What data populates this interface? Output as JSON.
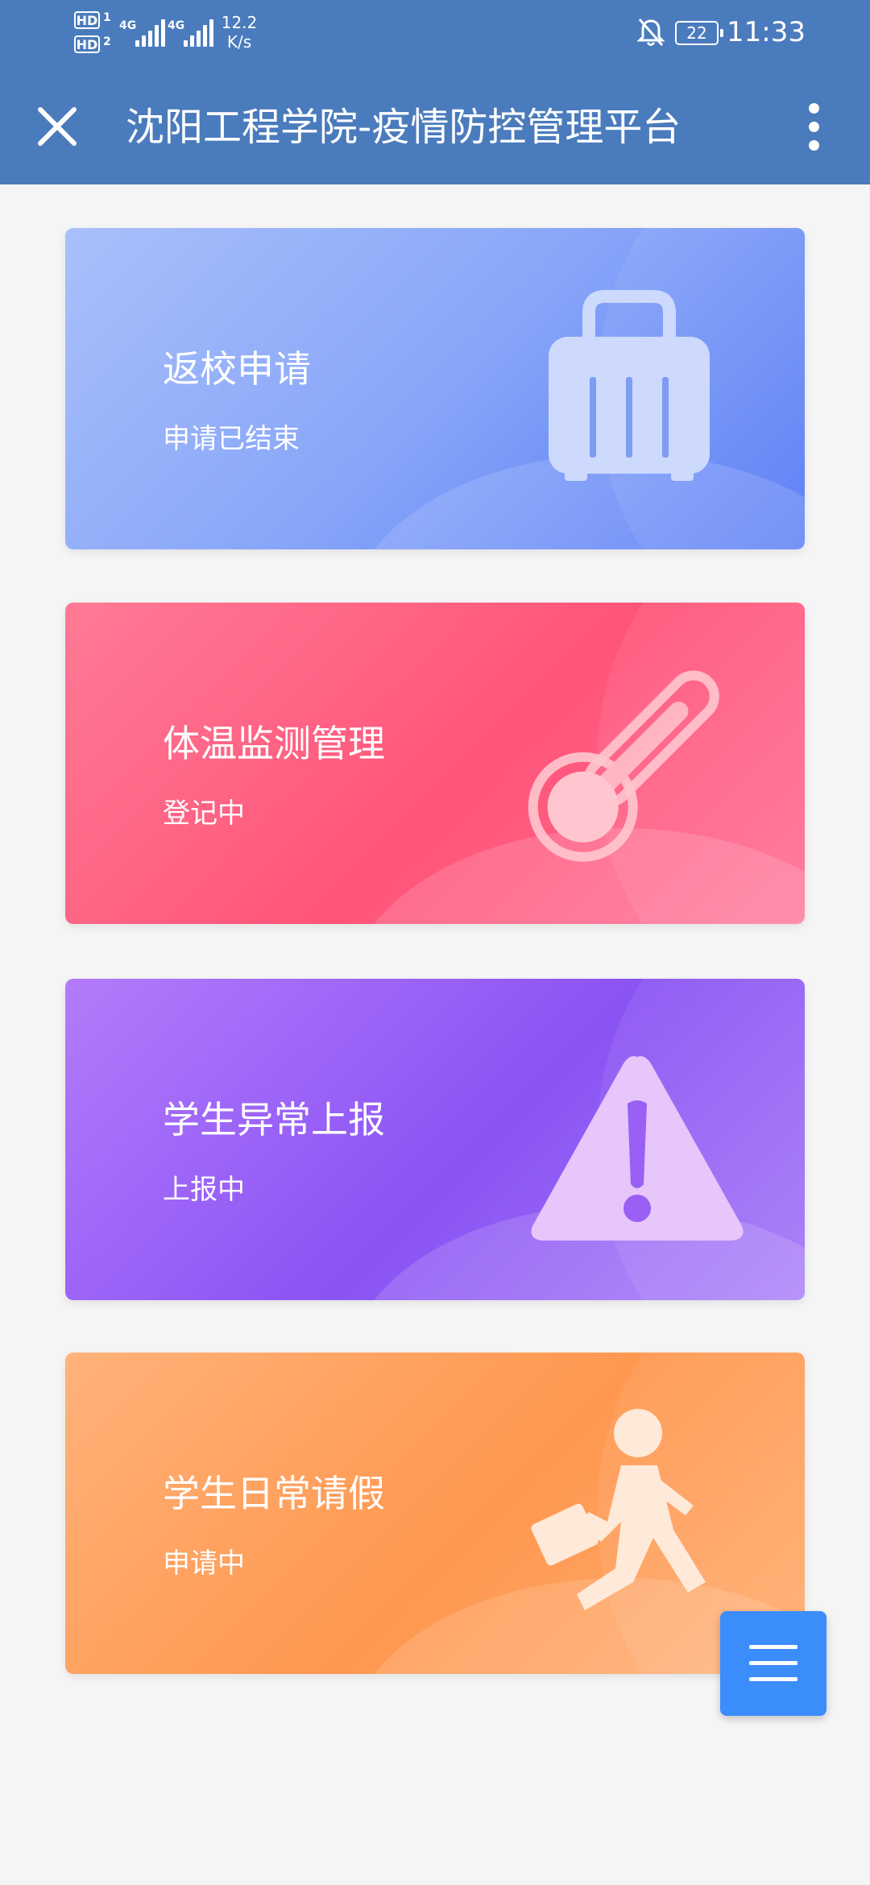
{
  "status_bar": {
    "hd1": "HD",
    "hd2": "HD",
    "sim1_index": "1",
    "sim2_index": "2",
    "network1": "4G",
    "network2": "4G",
    "net_speed_value": "12.2",
    "net_speed_unit": "K/s",
    "battery_level": "22",
    "time": "11:33"
  },
  "app_bar": {
    "title": "沈阳工程学院-疫情防控管理平台",
    "close_icon": "close-icon",
    "more_icon": "more-vertical-icon"
  },
  "cards": [
    {
      "title": "返校申请",
      "status": "申请已结束",
      "icon": "suitcase-icon",
      "color": "#88a6f8"
    },
    {
      "title": "体温监测管理",
      "status": "登记中",
      "icon": "thermometer-icon",
      "color": "#ff5478"
    },
    {
      "title": "学生异常上报",
      "status": "上报中",
      "icon": "warning-icon",
      "color": "#8a53f4"
    },
    {
      "title": "学生日常请假",
      "status": "申请中",
      "icon": "walking-person-icon",
      "color": "#ff974f"
    }
  ],
  "fab": {
    "icon": "menu-icon",
    "color": "#3a8dfb"
  }
}
